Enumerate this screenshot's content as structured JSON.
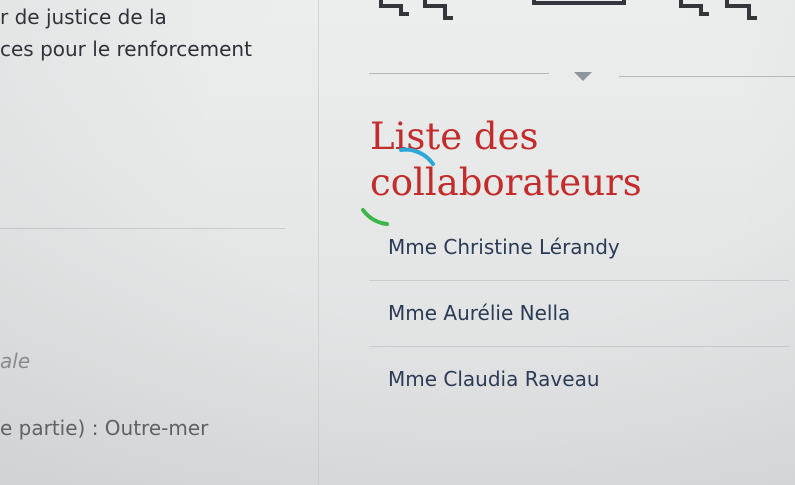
{
  "left": {
    "line1": "r de justice de la",
    "line2": "ces pour le renforcement",
    "italic_fragment": "ale",
    "bottom_line": "e partie) : Outre-mer"
  },
  "right": {
    "section_title": "Liste des collaborateurs",
    "collaborators": [
      "Mme Christine Lérandy",
      "Mme Aurélie Nella",
      "Mme Claudia Raveau"
    ]
  },
  "colors": {
    "title_red": "#c42b2b",
    "link_navy": "#2b3a55",
    "spinner_blue": "#2ba8d8",
    "spinner_green": "#3cb54a"
  },
  "icons": [
    "nav-glyph-icon",
    "dropdown-arrow-icon",
    "loading-spinner-icon"
  ]
}
